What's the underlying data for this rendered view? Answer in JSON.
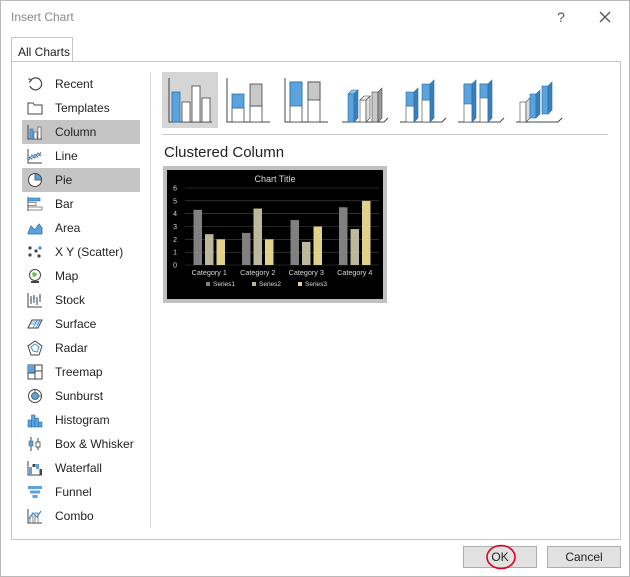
{
  "window": {
    "title": "Insert Chart",
    "help_glyph": "?"
  },
  "tabs": [
    {
      "label": "All Charts"
    }
  ],
  "sidebar": {
    "items": [
      {
        "label": "Recent",
        "icon": "recent-icon"
      },
      {
        "label": "Templates",
        "icon": "folder-icon"
      },
      {
        "label": "Column",
        "icon": "column-chart-icon",
        "state": "selected"
      },
      {
        "label": "Line",
        "icon": "line-chart-icon"
      },
      {
        "label": "Pie",
        "icon": "pie-chart-icon",
        "state": "hover"
      },
      {
        "label": "Bar",
        "icon": "bar-chart-icon"
      },
      {
        "label": "Area",
        "icon": "area-chart-icon"
      },
      {
        "label": "X Y (Scatter)",
        "icon": "scatter-chart-icon"
      },
      {
        "label": "Map",
        "icon": "map-chart-icon"
      },
      {
        "label": "Stock",
        "icon": "stock-chart-icon"
      },
      {
        "label": "Surface",
        "icon": "surface-chart-icon"
      },
      {
        "label": "Radar",
        "icon": "radar-chart-icon"
      },
      {
        "label": "Treemap",
        "icon": "treemap-chart-icon"
      },
      {
        "label": "Sunburst",
        "icon": "sunburst-chart-icon"
      },
      {
        "label": "Histogram",
        "icon": "histogram-chart-icon"
      },
      {
        "label": "Box & Whisker",
        "icon": "box-whisker-chart-icon"
      },
      {
        "label": "Waterfall",
        "icon": "waterfall-chart-icon"
      },
      {
        "label": "Funnel",
        "icon": "funnel-chart-icon"
      },
      {
        "label": "Combo",
        "icon": "combo-chart-icon"
      }
    ]
  },
  "subtypes": {
    "selected_title": "Clustered Column",
    "items": [
      {
        "icon": "clustered-column-icon",
        "selected": true
      },
      {
        "icon": "stacked-column-icon"
      },
      {
        "icon": "100-stacked-column-icon"
      },
      {
        "icon": "3d-clustered-column-icon"
      },
      {
        "icon": "3d-stacked-column-icon"
      },
      {
        "icon": "3d-100-stacked-column-icon"
      },
      {
        "icon": "3d-column-icon"
      }
    ]
  },
  "chart_data": {
    "type": "bar",
    "title": "Chart Title",
    "categories": [
      "Category 1",
      "Category 2",
      "Category 3",
      "Category 4"
    ],
    "series": [
      {
        "name": "Series1",
        "values": [
          4.3,
          2.5,
          3.5,
          4.5
        ]
      },
      {
        "name": "Series2",
        "values": [
          2.4,
          4.4,
          1.8,
          2.8
        ]
      },
      {
        "name": "Series3",
        "values": [
          2,
          2,
          3,
          5
        ]
      }
    ],
    "ylim": [
      0,
      6
    ],
    "yticks": [
      0,
      1,
      2,
      3,
      4,
      5,
      6
    ],
    "grid": true,
    "legend": "bottom",
    "colors": [
      "#808080",
      "#bcb89c",
      "#e2d18a"
    ],
    "background": "#000000",
    "text_color": "#d9d9d9"
  },
  "footer": {
    "ok_label": "OK",
    "cancel_label": "Cancel",
    "annotation_color": "#e0001b"
  }
}
